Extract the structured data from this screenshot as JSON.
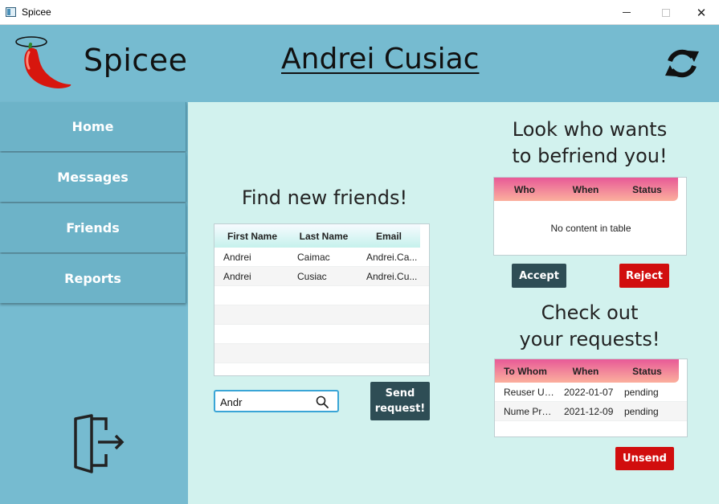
{
  "window": {
    "title": "Spicee",
    "minimize_icon": "minimize-icon",
    "maximize_icon": "maximize-icon",
    "close_glyph": "✕"
  },
  "header": {
    "brand": "Spicee",
    "user_name": "Andrei Cusiac",
    "logo_icon": "chili-pepper-halo-logo",
    "refresh_icon": "refresh-icon",
    "background_color": "#76bbd0"
  },
  "sidebar": {
    "items": [
      {
        "label": "Home"
      },
      {
        "label": "Messages"
      },
      {
        "label": "Friends"
      },
      {
        "label": "Reports"
      }
    ],
    "logout_icon": "logout-door-icon"
  },
  "find_friends": {
    "heading": "Find new friends!",
    "columns": [
      "First Name",
      "Last Name",
      "Email"
    ],
    "rows": [
      {
        "first_name": "Andrei",
        "last_name": "Caimac",
        "email": "Andrei.Ca..."
      },
      {
        "first_name": "Andrei",
        "last_name": "Cusiac",
        "email": "Andrei.Cu..."
      }
    ],
    "search": {
      "value": "Andr",
      "icon": "search-icon"
    },
    "send_button": {
      "line1": "Send",
      "line2": "request!"
    }
  },
  "befriend": {
    "heading_line1": "Look who wants",
    "heading_line2": "to befriend you!",
    "columns": [
      "Who",
      "When",
      "Status"
    ],
    "empty_text": "No content in table",
    "accept_label": "Accept",
    "reject_label": "Reject"
  },
  "requests": {
    "heading_line1": "Check out",
    "heading_line2": "your requests!",
    "columns": [
      "To Whom",
      "When",
      "Status"
    ],
    "rows": [
      {
        "to_whom": "Reuser User",
        "when": "2022-01-07",
        "status": "pending"
      },
      {
        "to_whom": "Nume Pre...",
        "when": "2021-12-09",
        "status": "pending"
      }
    ],
    "unsend_label": "Unsend"
  },
  "colors": {
    "main_background": "#d2f2ee",
    "dark_button": "#2e4d55",
    "red_button": "#d10e0e",
    "pink_header": "#e85a97"
  }
}
